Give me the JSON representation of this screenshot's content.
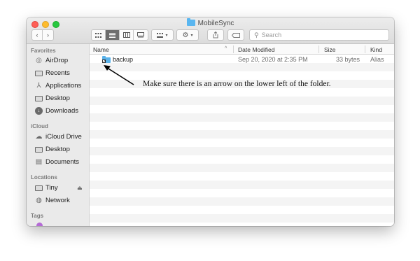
{
  "window": {
    "title": "MobileSync"
  },
  "toolbar": {
    "back_icon": "chevron-left",
    "forward_icon": "chevron-right",
    "view_modes": [
      "icon-view",
      "list-view",
      "column-view",
      "gallery-view"
    ],
    "active_view": "list-view",
    "arrange_icon": "group-icon",
    "action_icon": "gear-icon",
    "share_icon": "share-icon",
    "tag_icon": "tag-icon",
    "search_placeholder": "Search"
  },
  "sidebar": {
    "favorites_label": "Favorites",
    "favorites": [
      {
        "label": "AirDrop",
        "icon": "airdrop-icon"
      },
      {
        "label": "Recents",
        "icon": "recents-icon"
      },
      {
        "label": "Applications",
        "icon": "applications-icon"
      },
      {
        "label": "Desktop",
        "icon": "desktop-icon"
      },
      {
        "label": "Downloads",
        "icon": "downloads-icon"
      }
    ],
    "icloud_label": "iCloud",
    "icloud": [
      {
        "label": "iCloud Drive",
        "icon": "cloud-icon"
      },
      {
        "label": "Desktop",
        "icon": "desktop-icon"
      },
      {
        "label": "Documents",
        "icon": "documents-icon"
      }
    ],
    "locations_label": "Locations",
    "locations": [
      {
        "label": "Tiny",
        "icon": "drive-icon",
        "eject": "⏏"
      },
      {
        "label": "Network",
        "icon": "network-icon"
      }
    ],
    "tags_label": "Tags"
  },
  "list": {
    "columns": {
      "name": "Name",
      "date_modified": "Date Modified",
      "size": "Size",
      "kind": "Kind"
    },
    "rows": [
      {
        "name": "backup",
        "date_modified": "Sep 20, 2020 at 2:35 PM",
        "size": "33 bytes",
        "kind": "Alias"
      }
    ]
  },
  "annotation": {
    "text": "Make sure there is an arrow on the lower left of the folder."
  },
  "colors": {
    "folder": "#5bb3ea",
    "close": "#fe5f57",
    "minimize": "#febc2e",
    "maximize": "#28c840",
    "tag_purple": "#b56bd6"
  }
}
